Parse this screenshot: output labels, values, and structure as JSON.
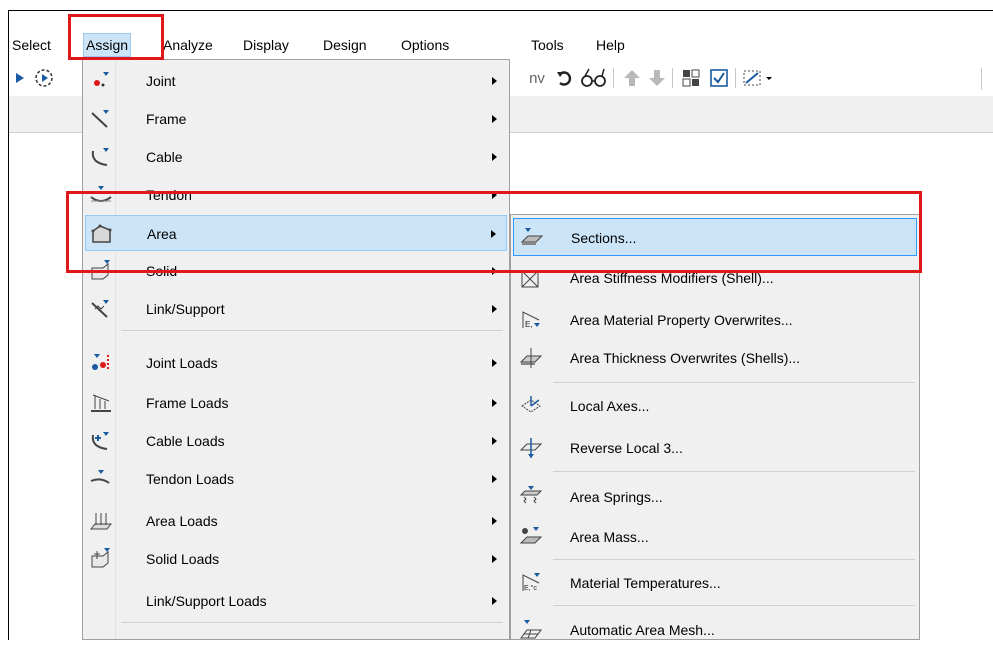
{
  "menubar": {
    "items": [
      {
        "label": "Select"
      },
      {
        "label": "Assign"
      },
      {
        "label": "Analyze"
      },
      {
        "label": "Display"
      },
      {
        "label": "Design"
      },
      {
        "label": "Options"
      },
      {
        "label": "Tools"
      },
      {
        "label": "Help"
      }
    ],
    "open_menu": "Assign"
  },
  "toolbar": {
    "text_label": "nv",
    "icons": [
      "play-icon",
      "run-step-icon",
      "undo-rotate-icon",
      "glasses-icon",
      "move-up-icon",
      "move-down-icon",
      "grid-select-icon",
      "checkbox-icon",
      "selection-dropdown-icon"
    ]
  },
  "assign_menu": {
    "items": [
      {
        "label": "Joint",
        "icon": "joint-icon",
        "submenu": true
      },
      {
        "label": "Frame",
        "icon": "frame-icon",
        "submenu": true
      },
      {
        "label": "Cable",
        "icon": "cable-icon",
        "submenu": true
      },
      {
        "label": "Tendon",
        "icon": "tendon-icon",
        "submenu": true
      },
      {
        "label": "Area",
        "icon": "area-icon",
        "submenu": true,
        "highlighted": true
      },
      {
        "label": "Solid",
        "icon": "solid-icon",
        "submenu": true
      },
      {
        "label": "Link/Support",
        "icon": "link-support-icon",
        "submenu": true
      },
      {
        "label": "Joint Loads",
        "icon": "joint-loads-icon",
        "submenu": true
      },
      {
        "label": "Frame Loads",
        "icon": "frame-loads-icon",
        "submenu": true
      },
      {
        "label": "Cable Loads",
        "icon": "cable-loads-icon",
        "submenu": true
      },
      {
        "label": "Tendon Loads",
        "icon": "tendon-loads-icon",
        "submenu": true
      },
      {
        "label": "Area Loads",
        "icon": "area-loads-icon",
        "submenu": true
      },
      {
        "label": "Solid Loads",
        "icon": "solid-loads-icon",
        "submenu": true
      },
      {
        "label": "Link/Support Loads",
        "icon": "",
        "submenu": true
      }
    ]
  },
  "area_submenu": {
    "items": [
      {
        "label": "Sections...",
        "icon": "area-sections-icon",
        "highlighted": true
      },
      {
        "label": "Area Stiffness Modifiers (Shell)...",
        "icon": "stiffness-modifiers-icon"
      },
      {
        "label": "Area Material Property Overwrites...",
        "icon": "material-overwrites-icon"
      },
      {
        "label": "Area Thickness Overwrites (Shells)...",
        "icon": "thickness-overwrites-icon"
      },
      {
        "label": "Local Axes...",
        "icon": "local-axes-icon"
      },
      {
        "label": "Reverse Local 3...",
        "icon": "reverse-local-icon"
      },
      {
        "label": "Area Springs...",
        "icon": "area-springs-icon"
      },
      {
        "label": "Area Mass...",
        "icon": "area-mass-icon"
      },
      {
        "label": "Material Temperatures...",
        "icon": "material-temperatures-icon"
      },
      {
        "label": "Automatic Area Mesh...",
        "icon": "auto-mesh-icon"
      }
    ]
  },
  "colors": {
    "highlight_fill": "#cce4f7",
    "highlight_border": "#3399ff",
    "annotation_red": "#e0181a",
    "menu_bg": "#f0f0f0"
  }
}
